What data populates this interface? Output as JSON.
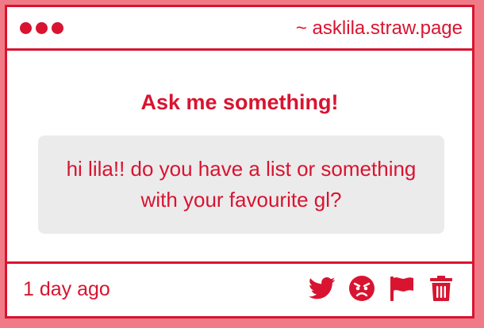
{
  "window": {
    "site_url": "~ asklila.straw.page"
  },
  "main": {
    "heading": "Ask me something!",
    "question": "hi lila!! do you have a list or something with your favourite gl?"
  },
  "footer": {
    "timestamp": "1 day ago",
    "actions": [
      {
        "icon": "twitter-icon"
      },
      {
        "icon": "angry-face-icon"
      },
      {
        "icon": "flag-icon"
      },
      {
        "icon": "trash-icon"
      }
    ]
  },
  "colors": {
    "accent": "#d81430",
    "page_background": "#f07b86",
    "card_background": "#ffffff",
    "question_background": "#ecebec"
  }
}
